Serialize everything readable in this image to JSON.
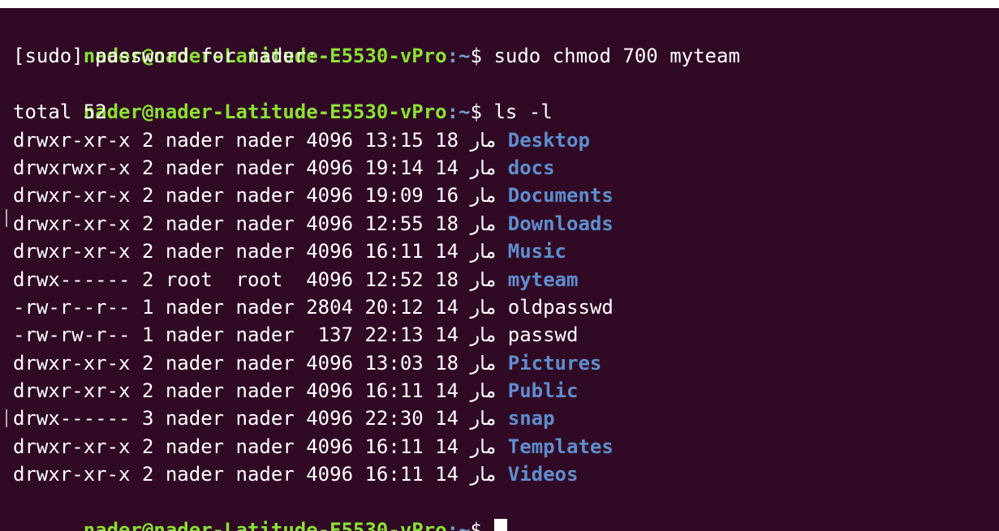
{
  "terminal": {
    "top_fragment": "            ",
    "prompt": {
      "user_host": "nader@nader-Latitude-E5530-vPro",
      "path": ":~",
      "symbol": "$ "
    },
    "commands": {
      "chmod": "sudo chmod 700 myteam",
      "ls": "ls -l"
    },
    "sudo_prompt": "[sudo] password for nader:",
    "total_line": "total 52",
    "listing": [
      {
        "meta": "drwxr-xr-x 2 nader nader 4096 13:15 18 ",
        "month": "مار",
        "name": "Desktop",
        "type": "dir"
      },
      {
        "meta": "drwxrwxr-x 2 nader nader 4096 19:14 14 ",
        "month": "مار",
        "name": "docs",
        "type": "dir"
      },
      {
        "meta": "drwxr-xr-x 2 nader nader 4096 19:09 16 ",
        "month": "مار",
        "name": "Documents",
        "type": "dir"
      },
      {
        "meta": "drwxr-xr-x 2 nader nader 4096 12:55 18 ",
        "month": "مار",
        "name": "Downloads",
        "type": "dir"
      },
      {
        "meta": "drwxr-xr-x 2 nader nader 4096 16:11 14 ",
        "month": "مار",
        "name": "Music",
        "type": "dir"
      },
      {
        "meta": "drwx------ 2 root  root  4096 12:52 18 ",
        "month": "مار",
        "name": "myteam",
        "type": "dir"
      },
      {
        "meta": "-rw-r--r-- 1 nader nader 2804 20:12 14 ",
        "month": "مار",
        "name": "oldpasswd",
        "type": "file"
      },
      {
        "meta": "-rw-rw-r-- 1 nader nader  137 22:13 14 ",
        "month": "مار",
        "name": "passwd",
        "type": "file"
      },
      {
        "meta": "drwxr-xr-x 2 nader nader 4096 13:03 18 ",
        "month": "مار",
        "name": "Pictures",
        "type": "dir"
      },
      {
        "meta": "drwxr-xr-x 2 nader nader 4096 16:11 14 ",
        "month": "مار",
        "name": "Public",
        "type": "dir"
      },
      {
        "meta": "drwx------ 3 nader nader 4096 22:30 14 ",
        "month": "مار",
        "name": "snap",
        "type": "dir"
      },
      {
        "meta": "drwxr-xr-x 2 nader nader 4096 16:11 14 ",
        "month": "مار",
        "name": "Templates",
        "type": "dir"
      },
      {
        "meta": "drwxr-xr-x 2 nader nader 4096 16:11 14 ",
        "month": "مار",
        "name": "Videos",
        "type": "dir"
      }
    ],
    "colors": {
      "background": "#300a24",
      "prompt_user": "#8ae234",
      "prompt_path": "#729fcf",
      "directory": "#5e8ecf",
      "text": "#ffffff"
    }
  }
}
